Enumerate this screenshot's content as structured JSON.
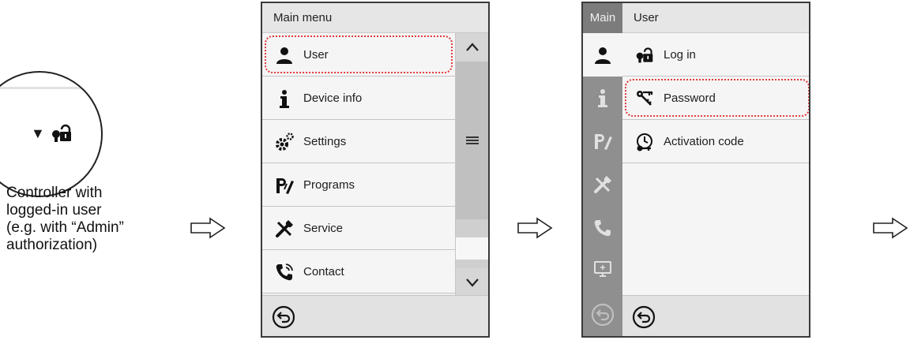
{
  "caption": {
    "line1": "Controller with",
    "line2": "logged-in user",
    "line3": "(e.g. with “Admin”",
    "line4": "authorization)"
  },
  "zoom": {
    "arrow_glyph": "▼",
    "lock_icon": "user-lock-icon"
  },
  "screen1": {
    "title": "Main menu",
    "items": [
      {
        "label": "User",
        "icon": "user-icon",
        "highlighted": true
      },
      {
        "label": "Device info",
        "icon": "info-icon"
      },
      {
        "label": "Settings",
        "icon": "gears-icon"
      },
      {
        "label": "Programs",
        "icon": "programs-icon"
      },
      {
        "label": "Service",
        "icon": "tools-icon"
      },
      {
        "label": "Contact",
        "icon": "phone-icon"
      }
    ],
    "scroll_up": "⌃",
    "scroll_down": "⌄"
  },
  "screen2": {
    "rail_label": "Main",
    "title": "User",
    "items": [
      {
        "label": "Log in",
        "icon": "user-lock-icon"
      },
      {
        "label": "Password",
        "icon": "keys-icon",
        "highlighted": true
      },
      {
        "label": "Activation code",
        "icon": "activation-code-icon"
      }
    ]
  },
  "colors": {
    "highlight": "#e03a3a",
    "rail": "#8f8f8f"
  }
}
